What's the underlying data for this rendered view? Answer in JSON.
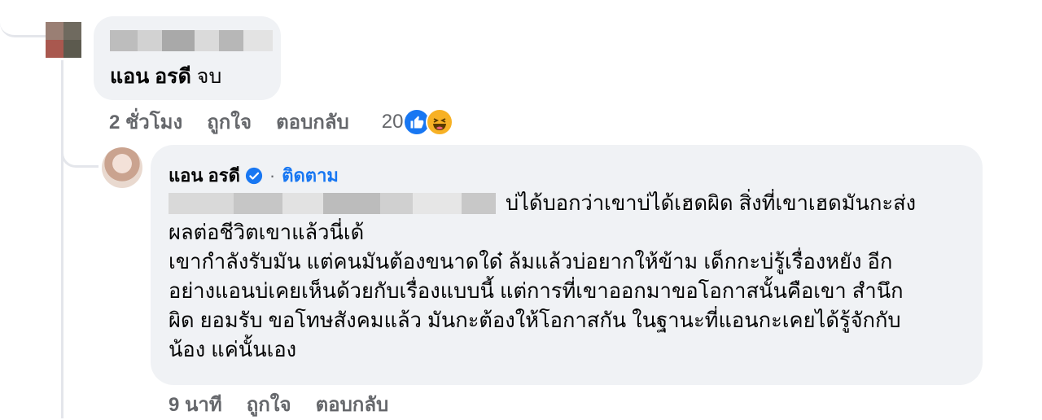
{
  "comment": {
    "text_name": "แอน อรดี",
    "text_rest": " จบ",
    "time": "2 ชั่วโมง",
    "like_label": "ถูกใจ",
    "reply_label": "ตอบกลับ",
    "reaction_count": "20",
    "reaction_icons": [
      "like-icon",
      "haha-icon"
    ]
  },
  "reply": {
    "author": "แอน อรดี",
    "separator": "·",
    "follow_label": "ติดตาม",
    "line1": "บ่ได้บอกว่าเขาบ่ได้เฮดผิด สิ่งที่เขาเฮดมันกะส่ง",
    "line2": "ผลต่อชีวิตเขาแล้วนี่เด้",
    "line3": "เขากำลังรับมัน แต่คนมันต้องขนาดใด๋ ล้มแล้วบ่อยากให้ข้าม เด็กกะบ่รู้เรื่องหยัง อีก",
    "line4": "อย่างแอนบ่เคยเห็นด้วยกับเรื่องแบบนี้ แต่การที่เขาออกมาขอโอกาสนั้นคือเขา สำนึก",
    "line5": "ผิด ยอมรับ ขอโทษสังคมแล้ว มันกะต้องให้โอกาสกัน ในฐานะที่แอนกะเคยได้รู้จักกับ",
    "line6": "น้อง แค่นั้นเอง",
    "time": "9 นาที",
    "like_label": "ถูกใจ",
    "reply_label": "ตอบกลับ",
    "verified_icon": "verified-badge-icon"
  },
  "colors": {
    "bubble": "#f0f2f5",
    "meta_text": "#65676b",
    "link_blue": "#1877f2",
    "thread_line": "#e4e6eb"
  }
}
